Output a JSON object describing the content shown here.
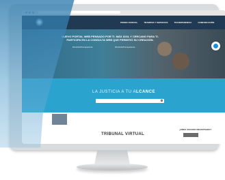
{
  "site": {
    "logo_text": "",
    "nav": [
      "PODER JUDICIAL",
      "TRAMITES Y SERVICIOS",
      "TRANSPARENCIA",
      "COMUNICACIÓN"
    ]
  },
  "hero": {
    "title": "NUEVO PORTAL WEB PENSADO POR TI. MÁS ÁGIL Y CERCANO PARA TI. PARTICIPA EN LA CONSULTA WEB QUE PERMITIÓ SU CREACIÓN.",
    "tag_a": "#JusticiaTransparente",
    "tag_b": "#JusticiaTransparente",
    "chat_label": ""
  },
  "search_band": {
    "title_prefix": "LA JUSTICIA A TU A",
    "title_highlight": "LCANCE",
    "subtitle": "",
    "search_placeholder": ""
  },
  "lower": {
    "tribunal_title": "TRIBUNAL VIRTUAL",
    "tribunal_desc": "",
    "register_question": "¿ERES USUARIO REGISTRADO?",
    "register_button": ""
  },
  "colors": {
    "nav": "#1f3a52",
    "band": "#2aa3cf",
    "overlay": "#2c7aad"
  },
  "icons": [
    "search-icon",
    "chat-icon",
    "logo-seal"
  ]
}
